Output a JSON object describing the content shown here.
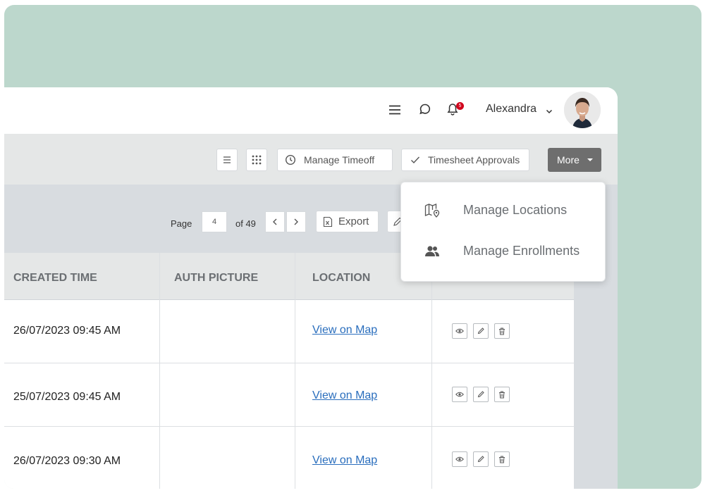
{
  "header": {
    "user_name": "Alexandra",
    "notification_count": "5",
    "icons": [
      "menu-icon",
      "chat-icon",
      "bell-icon",
      "chevron-down-icon"
    ]
  },
  "toolbar": {
    "manage_timeoff": "Manage Timeoff",
    "timesheet_approvals": "Timesheet Approvals",
    "more": "More"
  },
  "pagination": {
    "page_label": "Page",
    "current_page": "4",
    "of_label": "of 49",
    "export": "Export"
  },
  "table": {
    "columns": [
      "CREATED TIME",
      "AUTH PICTURE",
      "LOCATION"
    ],
    "rows": [
      {
        "created_time": "26/07/2023  09:45 AM",
        "location": "View on Map"
      },
      {
        "created_time": "25/07/2023  09:45 AM",
        "location": "View on Map"
      },
      {
        "created_time": "26/07/2023  09:30 AM",
        "location": "View on Map"
      }
    ]
  },
  "dropdown": {
    "items": [
      {
        "label": "Manage Locations",
        "icon": "map-pin-icon"
      },
      {
        "label": "Manage Enrollments",
        "icon": "users-icon"
      }
    ]
  },
  "colors": {
    "backdrop": "#bcd7cc",
    "toolbar_bg": "#e5e7e7",
    "filter_bg": "#d8dce0",
    "more_button": "#6e6e6e",
    "link": "#2a6ebd",
    "badge": "#d0021b"
  }
}
